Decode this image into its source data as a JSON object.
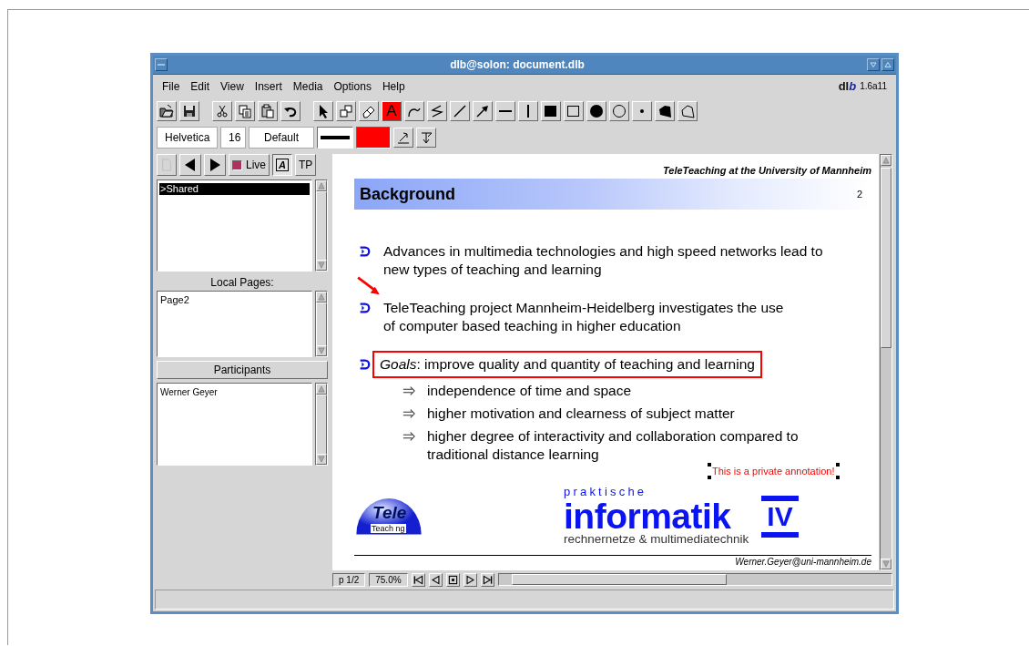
{
  "window": {
    "title": "dlb@solon: document.dlb"
  },
  "menu": [
    {
      "label": "File"
    },
    {
      "label": "Edit"
    },
    {
      "label": "View"
    },
    {
      "label": "Insert"
    },
    {
      "label": "Media"
    },
    {
      "label": "Options"
    },
    {
      "label": "Help"
    }
  ],
  "app_badge": {
    "logo_main": "dl",
    "logo_accent": "b",
    "version": "1.6a11"
  },
  "toolbar": {
    "text_tool": "A"
  },
  "format_bar": {
    "font": "Helvetica",
    "size": "16",
    "style": "Default"
  },
  "side_panel": {
    "live_button": "Live",
    "annotate_button": "A",
    "tp_button": "TP"
  },
  "shared_list": {
    "items": [
      {
        "label": ">Shared",
        "selected": true
      }
    ]
  },
  "local_pages": {
    "label": "Local Pages:",
    "items": [
      {
        "label": "Page2",
        "selected": false
      }
    ]
  },
  "participants": {
    "label": "Participants",
    "items": [
      {
        "label": "Werner Geyer",
        "selected": false
      }
    ]
  },
  "slide": {
    "header": "TeleTeaching at the University of Mannheim",
    "title": "Background",
    "number": "2",
    "bullets": [
      {
        "text": "Advances in multimedia technologies and high speed networks lead to\nnew types of teaching and learning",
        "highlighted": false
      },
      {
        "text": "TeleTeaching project Mannheim-Heidelberg investigates the use\nof computer based teaching in higher education",
        "highlighted": false
      },
      {
        "text": "*Goals*: improve quality and quantity of teaching and learning",
        "highlighted": true,
        "children": [
          {
            "text": "independence of time and space"
          },
          {
            "text": "higher motivation and clearness of subject matter"
          },
          {
            "text": "higher degree of interactivity and collaboration compared to\ntraditional distance learning"
          }
        ]
      }
    ],
    "annotation": "This is a private annotation!",
    "logos": {
      "tele": "Tele",
      "teaching": "Teach ng",
      "praktische": "praktische",
      "informatik": "informatik",
      "numeral": "IV",
      "subtitle": "rechnernetze & multimediatechnik"
    },
    "footer": "Werner.Geyer@uni-mannheim.de"
  },
  "navigation": {
    "page": "p 1/2",
    "zoom": "75.0%"
  }
}
